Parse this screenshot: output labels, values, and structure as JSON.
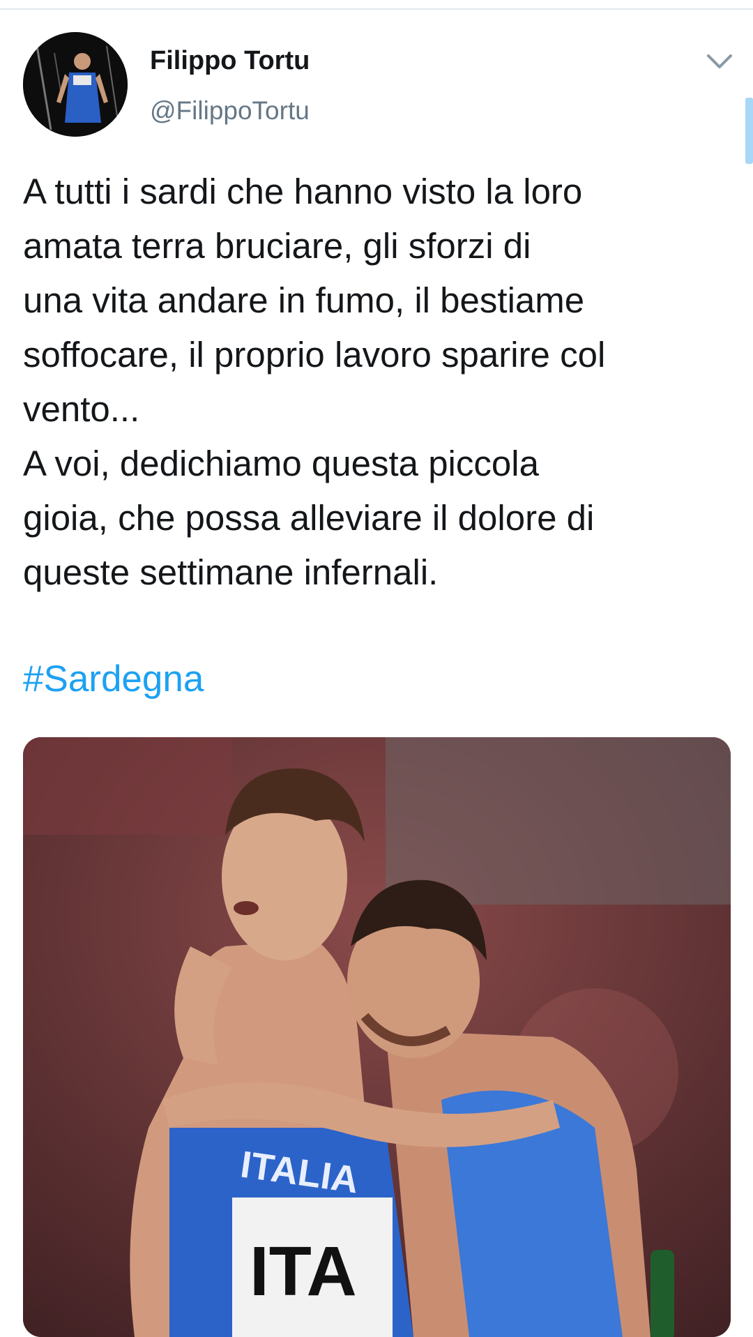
{
  "tweet": {
    "author": {
      "display_name": "Filippo Tortu",
      "handle": "@FilippoTortu",
      "avatar_icon": "profile-photo-avatar"
    },
    "menu_icon": "chevron-down-icon",
    "text_lines": [
      "A tutti i sardi che hanno visto la loro",
      "amata terra bruciare, gli sforzi di",
      "una vita andare in fumo, il bestiame",
      "soffocare, il proprio lavoro sparire col",
      "vento...",
      "A voi, dedichiamo questa piccola",
      "gioia, che possa alleviare il dolore di",
      "queste settimane infernali."
    ],
    "hashtag": "#Sardegna",
    "media": {
      "description_icon": "photo-two-athletes-embracing",
      "jersey_text": "ITALIA",
      "bib_text": "ITA"
    }
  },
  "colors": {
    "text": "#14171a",
    "secondary_text": "#657786",
    "link": "#1da1f2",
    "divider": "#e1e8ed"
  }
}
